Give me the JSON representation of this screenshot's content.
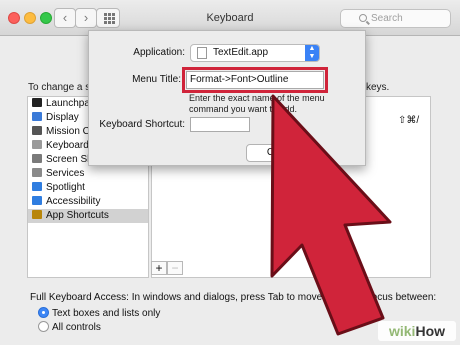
{
  "window": {
    "title": "Keyboard",
    "search_placeholder": "Search"
  },
  "background": {
    "left_partial": "To change a sh",
    "right_partial": "keys.",
    "shortcut_glyph": "⇧⌘/",
    "categories": [
      {
        "label": "Launchpad",
        "icon": "launchpad-icon",
        "color": "#222222"
      },
      {
        "label": "Display",
        "icon": "display-icon",
        "color": "#3a7ad8"
      },
      {
        "label": "Mission Co",
        "icon": "mission-control-icon",
        "color": "#555555"
      },
      {
        "label": "Keyboard",
        "icon": "keyboard-icon",
        "color": "#9a9a9a"
      },
      {
        "label": "Screen Sh",
        "icon": "screenshot-icon",
        "color": "#7a7a7a"
      },
      {
        "label": "Services",
        "icon": "gear-icon",
        "color": "#8a8a8a"
      },
      {
        "label": "Spotlight",
        "icon": "spotlight-icon",
        "color": "#2f7de0"
      },
      {
        "label": "Accessibility",
        "icon": "accessibility-icon",
        "color": "#2f7de0"
      },
      {
        "label": "App Shortcuts",
        "icon": "app-shortcuts-icon",
        "color": "#b8860b"
      }
    ],
    "add_label": "+",
    "remove_label": "−",
    "full_keyboard_access": "Full Keyboard Access: In windows and dialogs, press Tab to move keyboard focus between:",
    "radio_options": [
      {
        "label": "Text boxes and lists only",
        "selected": true
      },
      {
        "label": "All controls",
        "selected": false
      }
    ]
  },
  "sheet": {
    "application_label": "Application:",
    "application_value": "TextEdit.app",
    "menu_title_label": "Menu Title:",
    "menu_title_value": "Format->Font>Outline",
    "hint": "Enter the exact name of the menu command you want to add.",
    "keyboard_shortcut_label": "Keyboard Shortcut:",
    "keyboard_shortcut_value": "",
    "cancel_label": "Can"
  },
  "overlay": {
    "arrow_color": "#d0243a",
    "watermark_wiki": "wiki",
    "watermark_how": "How"
  }
}
